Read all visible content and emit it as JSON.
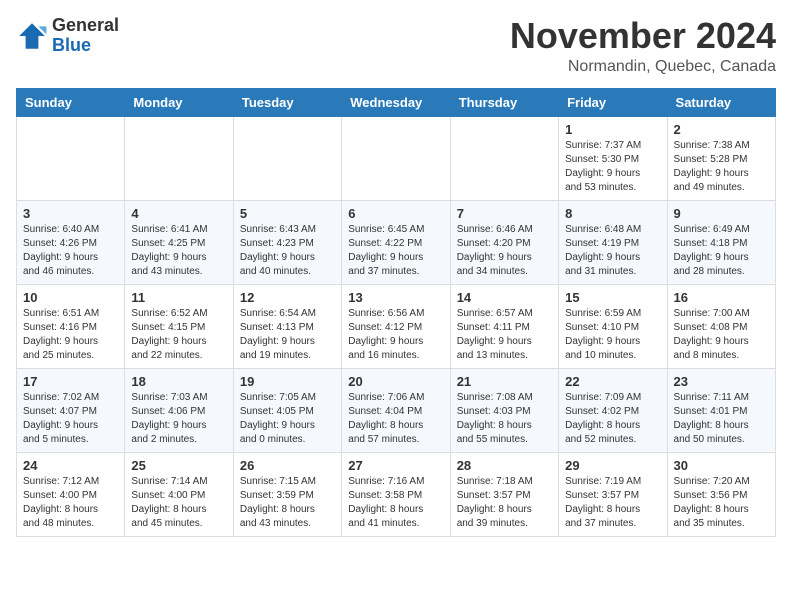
{
  "header": {
    "logo_line1": "General",
    "logo_line2": "Blue",
    "month": "November 2024",
    "location": "Normandin, Quebec, Canada"
  },
  "weekdays": [
    "Sunday",
    "Monday",
    "Tuesday",
    "Wednesday",
    "Thursday",
    "Friday",
    "Saturday"
  ],
  "weeks": [
    [
      {
        "day": "",
        "info": ""
      },
      {
        "day": "",
        "info": ""
      },
      {
        "day": "",
        "info": ""
      },
      {
        "day": "",
        "info": ""
      },
      {
        "day": "",
        "info": ""
      },
      {
        "day": "1",
        "info": "Sunrise: 7:37 AM\nSunset: 5:30 PM\nDaylight: 9 hours\nand 53 minutes."
      },
      {
        "day": "2",
        "info": "Sunrise: 7:38 AM\nSunset: 5:28 PM\nDaylight: 9 hours\nand 49 minutes."
      }
    ],
    [
      {
        "day": "3",
        "info": "Sunrise: 6:40 AM\nSunset: 4:26 PM\nDaylight: 9 hours\nand 46 minutes."
      },
      {
        "day": "4",
        "info": "Sunrise: 6:41 AM\nSunset: 4:25 PM\nDaylight: 9 hours\nand 43 minutes."
      },
      {
        "day": "5",
        "info": "Sunrise: 6:43 AM\nSunset: 4:23 PM\nDaylight: 9 hours\nand 40 minutes."
      },
      {
        "day": "6",
        "info": "Sunrise: 6:45 AM\nSunset: 4:22 PM\nDaylight: 9 hours\nand 37 minutes."
      },
      {
        "day": "7",
        "info": "Sunrise: 6:46 AM\nSunset: 4:20 PM\nDaylight: 9 hours\nand 34 minutes."
      },
      {
        "day": "8",
        "info": "Sunrise: 6:48 AM\nSunset: 4:19 PM\nDaylight: 9 hours\nand 31 minutes."
      },
      {
        "day": "9",
        "info": "Sunrise: 6:49 AM\nSunset: 4:18 PM\nDaylight: 9 hours\nand 28 minutes."
      }
    ],
    [
      {
        "day": "10",
        "info": "Sunrise: 6:51 AM\nSunset: 4:16 PM\nDaylight: 9 hours\nand 25 minutes."
      },
      {
        "day": "11",
        "info": "Sunrise: 6:52 AM\nSunset: 4:15 PM\nDaylight: 9 hours\nand 22 minutes."
      },
      {
        "day": "12",
        "info": "Sunrise: 6:54 AM\nSunset: 4:13 PM\nDaylight: 9 hours\nand 19 minutes."
      },
      {
        "day": "13",
        "info": "Sunrise: 6:56 AM\nSunset: 4:12 PM\nDaylight: 9 hours\nand 16 minutes."
      },
      {
        "day": "14",
        "info": "Sunrise: 6:57 AM\nSunset: 4:11 PM\nDaylight: 9 hours\nand 13 minutes."
      },
      {
        "day": "15",
        "info": "Sunrise: 6:59 AM\nSunset: 4:10 PM\nDaylight: 9 hours\nand 10 minutes."
      },
      {
        "day": "16",
        "info": "Sunrise: 7:00 AM\nSunset: 4:08 PM\nDaylight: 9 hours\nand 8 minutes."
      }
    ],
    [
      {
        "day": "17",
        "info": "Sunrise: 7:02 AM\nSunset: 4:07 PM\nDaylight: 9 hours\nand 5 minutes."
      },
      {
        "day": "18",
        "info": "Sunrise: 7:03 AM\nSunset: 4:06 PM\nDaylight: 9 hours\nand 2 minutes."
      },
      {
        "day": "19",
        "info": "Sunrise: 7:05 AM\nSunset: 4:05 PM\nDaylight: 9 hours\nand 0 minutes."
      },
      {
        "day": "20",
        "info": "Sunrise: 7:06 AM\nSunset: 4:04 PM\nDaylight: 8 hours\nand 57 minutes."
      },
      {
        "day": "21",
        "info": "Sunrise: 7:08 AM\nSunset: 4:03 PM\nDaylight: 8 hours\nand 55 minutes."
      },
      {
        "day": "22",
        "info": "Sunrise: 7:09 AM\nSunset: 4:02 PM\nDaylight: 8 hours\nand 52 minutes."
      },
      {
        "day": "23",
        "info": "Sunrise: 7:11 AM\nSunset: 4:01 PM\nDaylight: 8 hours\nand 50 minutes."
      }
    ],
    [
      {
        "day": "24",
        "info": "Sunrise: 7:12 AM\nSunset: 4:00 PM\nDaylight: 8 hours\nand 48 minutes."
      },
      {
        "day": "25",
        "info": "Sunrise: 7:14 AM\nSunset: 4:00 PM\nDaylight: 8 hours\nand 45 minutes."
      },
      {
        "day": "26",
        "info": "Sunrise: 7:15 AM\nSunset: 3:59 PM\nDaylight: 8 hours\nand 43 minutes."
      },
      {
        "day": "27",
        "info": "Sunrise: 7:16 AM\nSunset: 3:58 PM\nDaylight: 8 hours\nand 41 minutes."
      },
      {
        "day": "28",
        "info": "Sunrise: 7:18 AM\nSunset: 3:57 PM\nDaylight: 8 hours\nand 39 minutes."
      },
      {
        "day": "29",
        "info": "Sunrise: 7:19 AM\nSunset: 3:57 PM\nDaylight: 8 hours\nand 37 minutes."
      },
      {
        "day": "30",
        "info": "Sunrise: 7:20 AM\nSunset: 3:56 PM\nDaylight: 8 hours\nand 35 minutes."
      }
    ]
  ]
}
